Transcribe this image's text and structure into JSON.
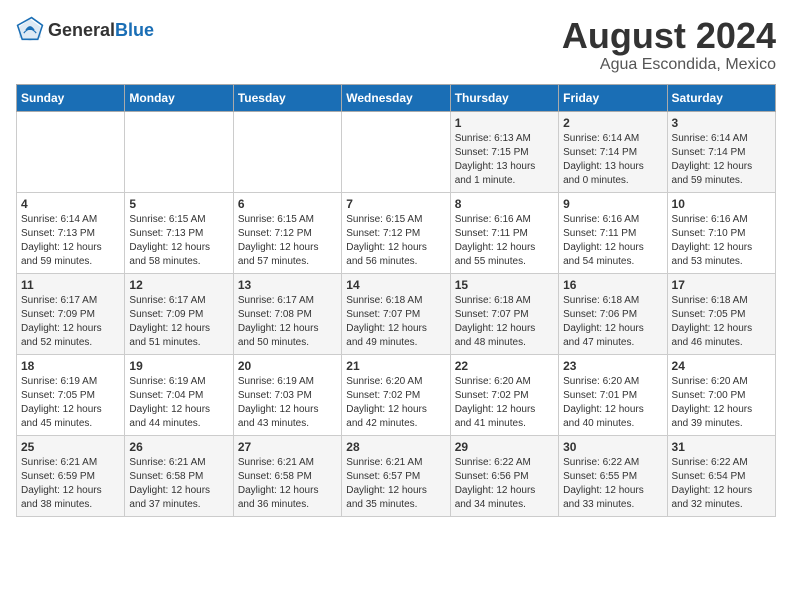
{
  "header": {
    "logo_general": "General",
    "logo_blue": "Blue",
    "title": "August 2024",
    "subtitle": "Agua Escondida, Mexico"
  },
  "days_of_week": [
    "Sunday",
    "Monday",
    "Tuesday",
    "Wednesday",
    "Thursday",
    "Friday",
    "Saturday"
  ],
  "weeks": [
    [
      {
        "day": "",
        "info": ""
      },
      {
        "day": "",
        "info": ""
      },
      {
        "day": "",
        "info": ""
      },
      {
        "day": "",
        "info": ""
      },
      {
        "day": "1",
        "info": "Sunrise: 6:13 AM\nSunset: 7:15 PM\nDaylight: 13 hours\nand 1 minute."
      },
      {
        "day": "2",
        "info": "Sunrise: 6:14 AM\nSunset: 7:14 PM\nDaylight: 13 hours\nand 0 minutes."
      },
      {
        "day": "3",
        "info": "Sunrise: 6:14 AM\nSunset: 7:14 PM\nDaylight: 12 hours\nand 59 minutes."
      }
    ],
    [
      {
        "day": "4",
        "info": "Sunrise: 6:14 AM\nSunset: 7:13 PM\nDaylight: 12 hours\nand 59 minutes."
      },
      {
        "day": "5",
        "info": "Sunrise: 6:15 AM\nSunset: 7:13 PM\nDaylight: 12 hours\nand 58 minutes."
      },
      {
        "day": "6",
        "info": "Sunrise: 6:15 AM\nSunset: 7:12 PM\nDaylight: 12 hours\nand 57 minutes."
      },
      {
        "day": "7",
        "info": "Sunrise: 6:15 AM\nSunset: 7:12 PM\nDaylight: 12 hours\nand 56 minutes."
      },
      {
        "day": "8",
        "info": "Sunrise: 6:16 AM\nSunset: 7:11 PM\nDaylight: 12 hours\nand 55 minutes."
      },
      {
        "day": "9",
        "info": "Sunrise: 6:16 AM\nSunset: 7:11 PM\nDaylight: 12 hours\nand 54 minutes."
      },
      {
        "day": "10",
        "info": "Sunrise: 6:16 AM\nSunset: 7:10 PM\nDaylight: 12 hours\nand 53 minutes."
      }
    ],
    [
      {
        "day": "11",
        "info": "Sunrise: 6:17 AM\nSunset: 7:09 PM\nDaylight: 12 hours\nand 52 minutes."
      },
      {
        "day": "12",
        "info": "Sunrise: 6:17 AM\nSunset: 7:09 PM\nDaylight: 12 hours\nand 51 minutes."
      },
      {
        "day": "13",
        "info": "Sunrise: 6:17 AM\nSunset: 7:08 PM\nDaylight: 12 hours\nand 50 minutes."
      },
      {
        "day": "14",
        "info": "Sunrise: 6:18 AM\nSunset: 7:07 PM\nDaylight: 12 hours\nand 49 minutes."
      },
      {
        "day": "15",
        "info": "Sunrise: 6:18 AM\nSunset: 7:07 PM\nDaylight: 12 hours\nand 48 minutes."
      },
      {
        "day": "16",
        "info": "Sunrise: 6:18 AM\nSunset: 7:06 PM\nDaylight: 12 hours\nand 47 minutes."
      },
      {
        "day": "17",
        "info": "Sunrise: 6:18 AM\nSunset: 7:05 PM\nDaylight: 12 hours\nand 46 minutes."
      }
    ],
    [
      {
        "day": "18",
        "info": "Sunrise: 6:19 AM\nSunset: 7:05 PM\nDaylight: 12 hours\nand 45 minutes."
      },
      {
        "day": "19",
        "info": "Sunrise: 6:19 AM\nSunset: 7:04 PM\nDaylight: 12 hours\nand 44 minutes."
      },
      {
        "day": "20",
        "info": "Sunrise: 6:19 AM\nSunset: 7:03 PM\nDaylight: 12 hours\nand 43 minutes."
      },
      {
        "day": "21",
        "info": "Sunrise: 6:20 AM\nSunset: 7:02 PM\nDaylight: 12 hours\nand 42 minutes."
      },
      {
        "day": "22",
        "info": "Sunrise: 6:20 AM\nSunset: 7:02 PM\nDaylight: 12 hours\nand 41 minutes."
      },
      {
        "day": "23",
        "info": "Sunrise: 6:20 AM\nSunset: 7:01 PM\nDaylight: 12 hours\nand 40 minutes."
      },
      {
        "day": "24",
        "info": "Sunrise: 6:20 AM\nSunset: 7:00 PM\nDaylight: 12 hours\nand 39 minutes."
      }
    ],
    [
      {
        "day": "25",
        "info": "Sunrise: 6:21 AM\nSunset: 6:59 PM\nDaylight: 12 hours\nand 38 minutes."
      },
      {
        "day": "26",
        "info": "Sunrise: 6:21 AM\nSunset: 6:58 PM\nDaylight: 12 hours\nand 37 minutes."
      },
      {
        "day": "27",
        "info": "Sunrise: 6:21 AM\nSunset: 6:58 PM\nDaylight: 12 hours\nand 36 minutes."
      },
      {
        "day": "28",
        "info": "Sunrise: 6:21 AM\nSunset: 6:57 PM\nDaylight: 12 hours\nand 35 minutes."
      },
      {
        "day": "29",
        "info": "Sunrise: 6:22 AM\nSunset: 6:56 PM\nDaylight: 12 hours\nand 34 minutes."
      },
      {
        "day": "30",
        "info": "Sunrise: 6:22 AM\nSunset: 6:55 PM\nDaylight: 12 hours\nand 33 minutes."
      },
      {
        "day": "31",
        "info": "Sunrise: 6:22 AM\nSunset: 6:54 PM\nDaylight: 12 hours\nand 32 minutes."
      }
    ]
  ]
}
